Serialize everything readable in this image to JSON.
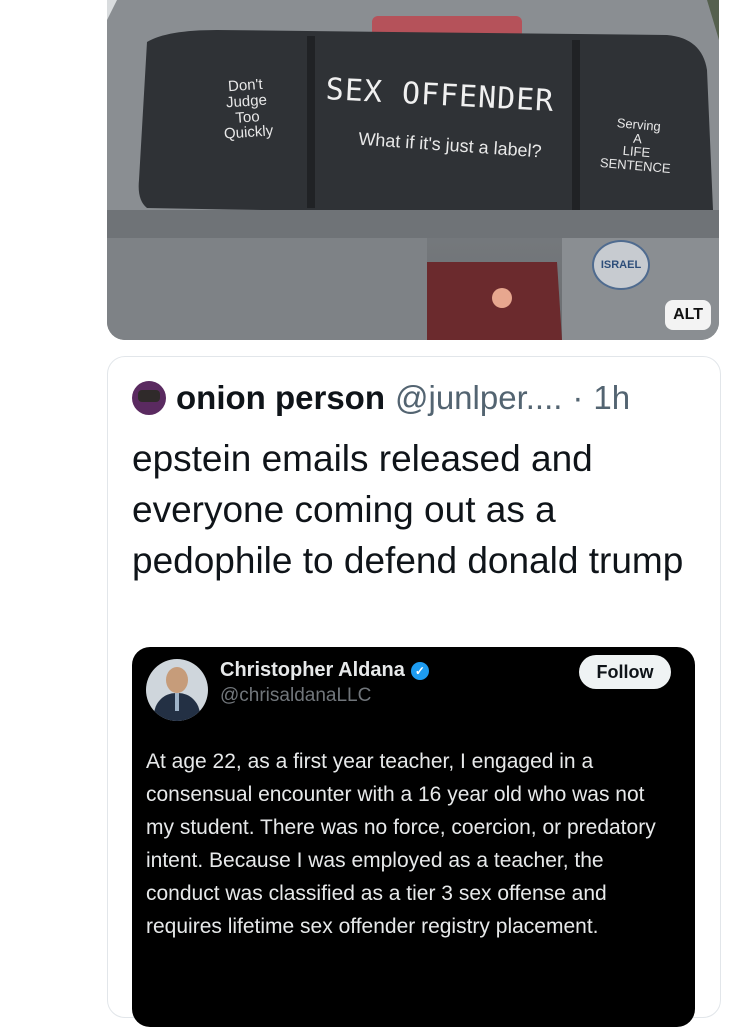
{
  "photo": {
    "sticker_left": "Don't\nJudge\nToo\nQuickly",
    "sticker_main": "SEX OFFENDER",
    "sticker_sub": "What if it's just a label?",
    "sticker_right": "Serving\nA\nLIFE\nSENTENCE",
    "badge": "ISRAEL",
    "alt_label": "ALT"
  },
  "post": {
    "author": "onion person",
    "handle": "@junlper....",
    "dot": "·",
    "time": "1h",
    "text": "epstein emails released and everyone coming out as a pedophile to defend donald trump"
  },
  "embed": {
    "name": "Christopher Aldana",
    "handle": "@chrisaldanaLLC",
    "follow_label": "Follow",
    "body": "At age 22, as a first year teacher, I engaged in a consensual encounter with a 16 year old who was not my student. There was no force, coercion, or predatory intent. Because I was employed as a teacher, the conduct was classified as a tier 3 sex offense and requires lifetime sex offender registry placement."
  },
  "colors": {
    "text_primary": "#0f1419",
    "text_secondary": "#536471",
    "embed_bg": "#000000",
    "verified": "#1d9bf0"
  }
}
